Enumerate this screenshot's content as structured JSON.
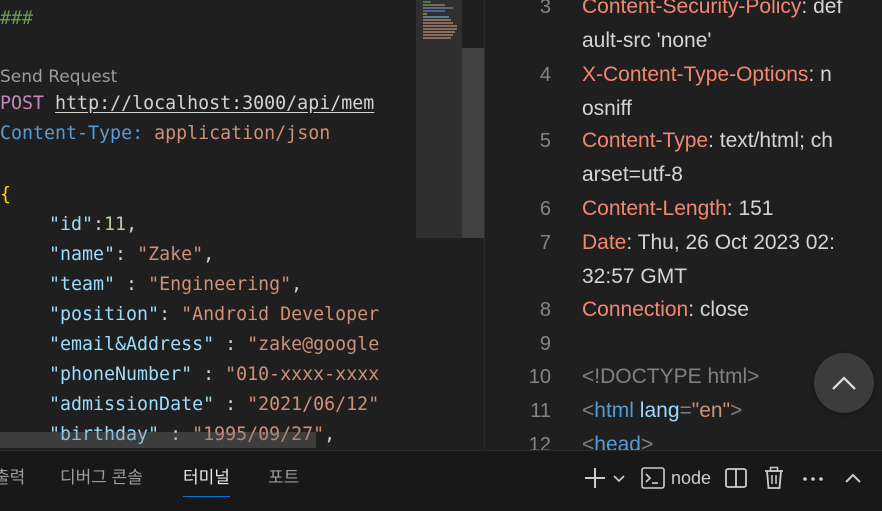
{
  "editor": {
    "separator": "###",
    "codelens": "Send Request",
    "request_method": "POST",
    "request_url": "http://localhost:3000/api/mem",
    "header_name": "Content-Type:",
    "header_value": "application/json",
    "open_brace": "{",
    "json_lines": [
      {
        "key": "\"id\"",
        "sep": ":",
        "value": "11",
        "type": "num",
        "end": ","
      },
      {
        "key": "\"name\"",
        "sep": ": ",
        "value": "\"Zake\"",
        "type": "str",
        "end": ","
      },
      {
        "key": "\"team\"",
        "sep": " : ",
        "value": "\"Engineering\"",
        "type": "str",
        "end": ","
      },
      {
        "key": "\"position\"",
        "sep": ": ",
        "value": "\"Android Developer",
        "type": "str",
        "end": ""
      },
      {
        "key": "\"email&Address\"",
        "sep": " : ",
        "value": "\"zake@google",
        "type": "str",
        "end": ""
      },
      {
        "key": "\"phoneNumber\"",
        "sep": " : ",
        "value": "\"010-xxxx-xxxx",
        "type": "str",
        "end": ""
      },
      {
        "key": "\"admissionDate\"",
        "sep": " : ",
        "value": "\"2021/06/12\"",
        "type": "str",
        "end": ""
      },
      {
        "key": "\"birthday\"",
        "sep": " : ",
        "value": "\"1995/09/27\"",
        "type": "str",
        "end": ","
      }
    ]
  },
  "response": {
    "headers": [
      {
        "line": "3",
        "name": "Content-Security-Policy",
        "l1": ": def",
        "l2": "ault-src 'none'"
      },
      {
        "line": "4",
        "name": "X-Content-Type-Options",
        "l1": ": n",
        "l2": "osniff"
      },
      {
        "line": "5",
        "name": "Content-Type",
        "l1": ": text/html; ch",
        "l2": "arset=utf-8"
      },
      {
        "line": "6",
        "name": "Content-Length",
        "l1": ": 151",
        "l2": ""
      },
      {
        "line": "7",
        "name": "Date",
        "l1": ": Thu, 26 Oct 2023 02:",
        "l2": "32:57 GMT"
      },
      {
        "line": "8",
        "name": "Connection",
        "l1": ": close",
        "l2": ""
      }
    ],
    "blank_line": "9",
    "doctype_line": "10",
    "doctype": "<!DOCTYPE html>",
    "html_line": "11",
    "html_open": "<",
    "html_tag": "html",
    "html_attr": "lang",
    "html_eq": "=",
    "html_val": "\"en\"",
    "html_close": ">",
    "head_line": "12",
    "head_open": "<",
    "head_tag": "head",
    "head_close": ">"
  },
  "panel": {
    "tabs": [
      "출력",
      "디버그 콘솔",
      "터미널",
      "포트"
    ],
    "active_tab": "터미널",
    "terminal_name": "node",
    "icons": [
      "add-terminal-icon",
      "chevron-down-icon",
      "terminal-icon",
      "split-editor-icon",
      "trash-icon",
      "more-icon",
      "chevron-up-icon"
    ]
  },
  "colors": {
    "accent": "#0078d4",
    "background": "#1f1f1f",
    "header_name": "#f48771"
  }
}
